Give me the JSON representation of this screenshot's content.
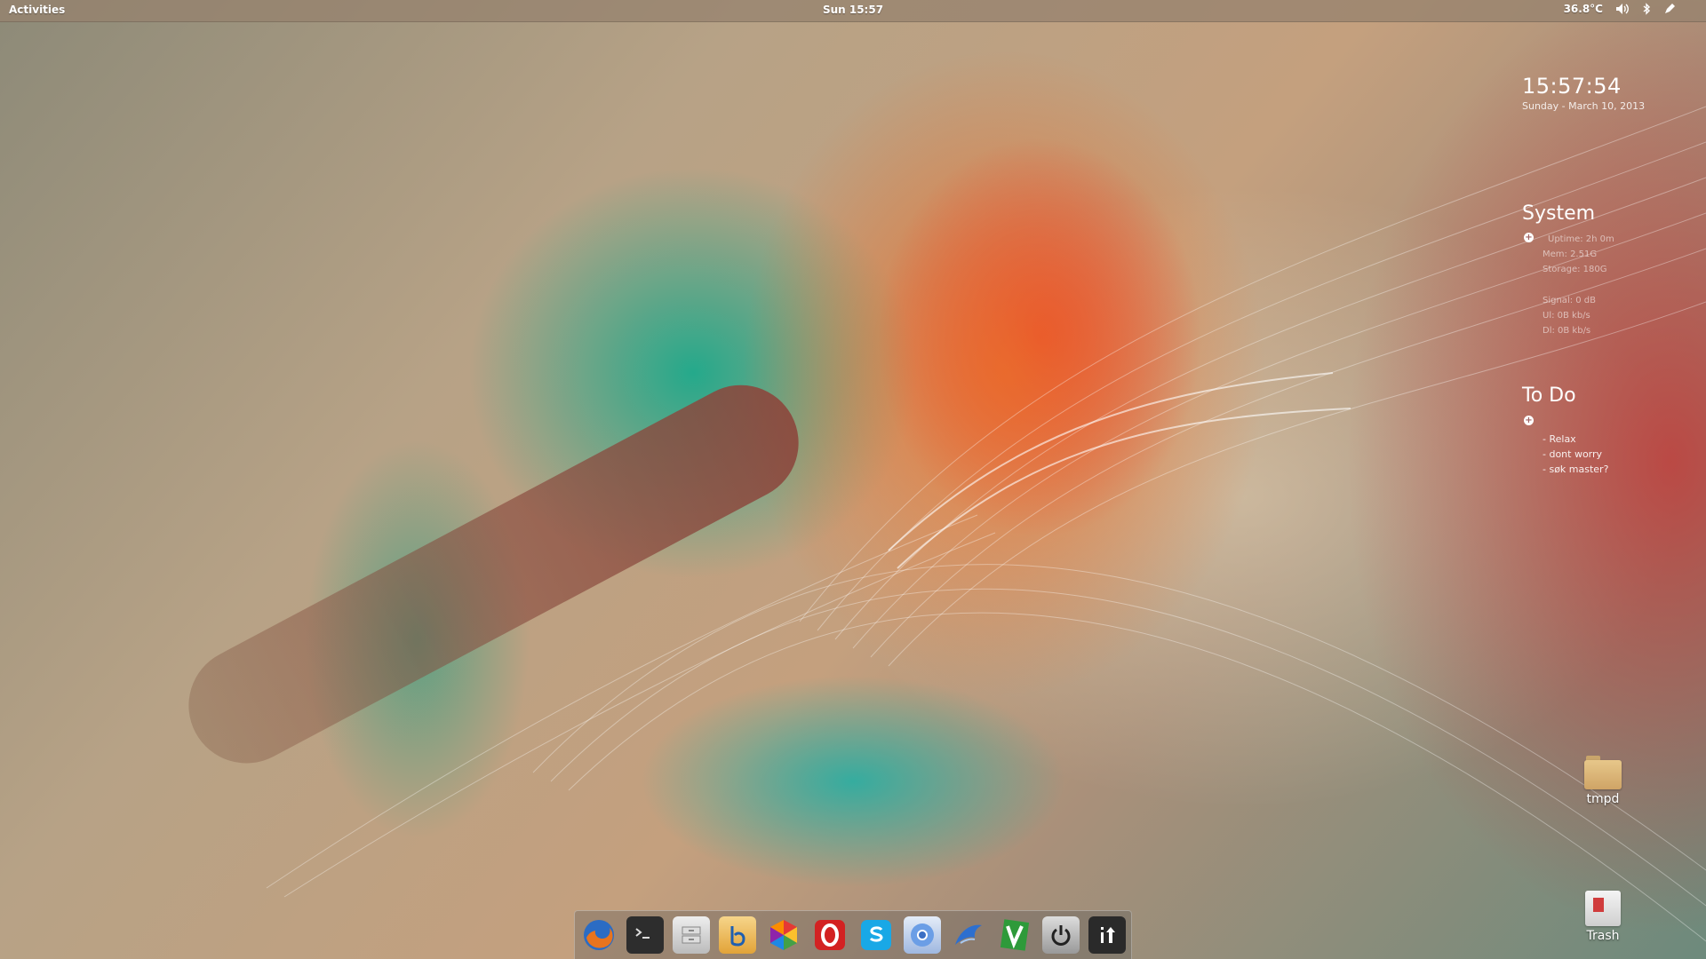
{
  "topbar": {
    "activities_label": "Activities",
    "clock": "Sun 15:57",
    "temperature": "36.8°C",
    "icons": [
      "volume-icon",
      "bluetooth-icon",
      "pen-icon"
    ]
  },
  "time_widget": {
    "time": "15:57:54",
    "date": "Sunday - March 10, 2013"
  },
  "system_widget": {
    "title": "System",
    "lines": [
      "Uptime: 2h 0m",
      "Mem: 2.51G",
      "Storage: 180G",
      "Signal: 0 dB",
      "Ul: 0B kb/s",
      "Dl: 0B kb/s"
    ]
  },
  "todo_widget": {
    "title": "To Do",
    "items": [
      "- Relax",
      "- dont worry",
      "- søk master?"
    ]
  },
  "desktop_icons": {
    "folder_label": "tmpd",
    "trash_label": "Trash"
  },
  "dock": {
    "items": [
      "firefox-icon",
      "terminal-icon",
      "files-icon",
      "bluefish-icon",
      "picasa-icon",
      "opera-icon",
      "skype-icon",
      "chromium-icon",
      "thunderbird-icon",
      "vim-icon",
      "power-icon",
      "show-apps-icon"
    ]
  },
  "colors": {
    "topbar_bg": "#968270",
    "accent_red": "#d03c3c",
    "teal_leaf": "#14aa8c",
    "orange_leaf": "#eb6e28"
  }
}
